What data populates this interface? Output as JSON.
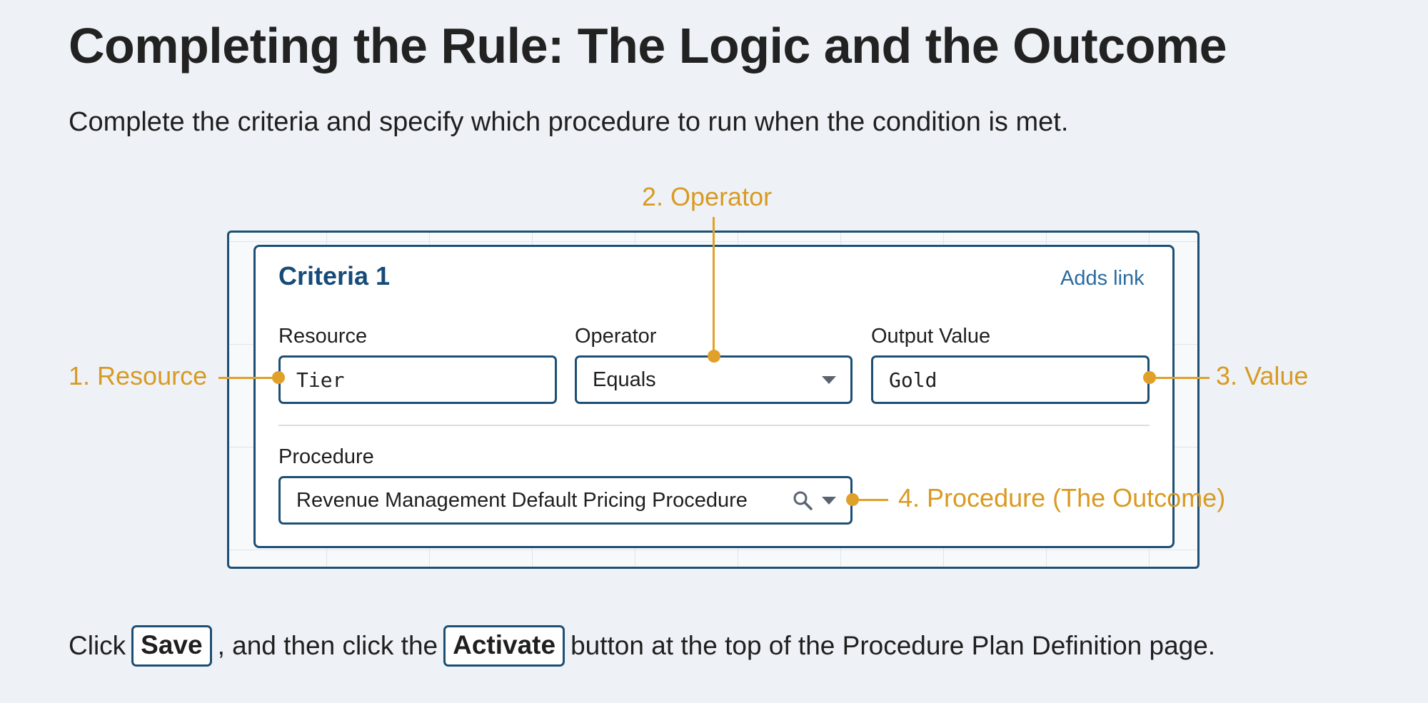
{
  "page": {
    "title": "Completing the Rule: The Logic and the Outcome",
    "subtitle": "Complete the criteria and specify which procedure to run when the condition is met."
  },
  "criteria": {
    "title": "Criteria 1",
    "link": "Adds link",
    "resource": {
      "label": "Resource",
      "value": "Tier"
    },
    "operator": {
      "label": "Operator",
      "value": "Equals"
    },
    "output_value": {
      "label": "Output Value",
      "value": "Gold"
    },
    "procedure": {
      "label": "Procedure",
      "value": "Revenue Management Default Pricing Procedure"
    }
  },
  "callouts": {
    "resource": "1. Resource",
    "operator": "2. Operator",
    "value": "3. Value",
    "procedure": "4. Procedure (The Outcome)"
  },
  "instruction": {
    "before": "Click",
    "save_label": "Save",
    "middle": ", and then click the",
    "activate_label": "Activate",
    "after": "button at the top of the Procedure Plan Definition page."
  },
  "icons": {
    "procedure_search": "search-icon",
    "operator_dropdown": "chevron-down-icon",
    "procedure_dropdown": "chevron-down-icon"
  },
  "colors": {
    "accent": "#e0a02a",
    "border": "#1d4f74",
    "title_blue": "#164b79",
    "link_blue": "#2a6b9f",
    "background": "#eef2f7"
  }
}
